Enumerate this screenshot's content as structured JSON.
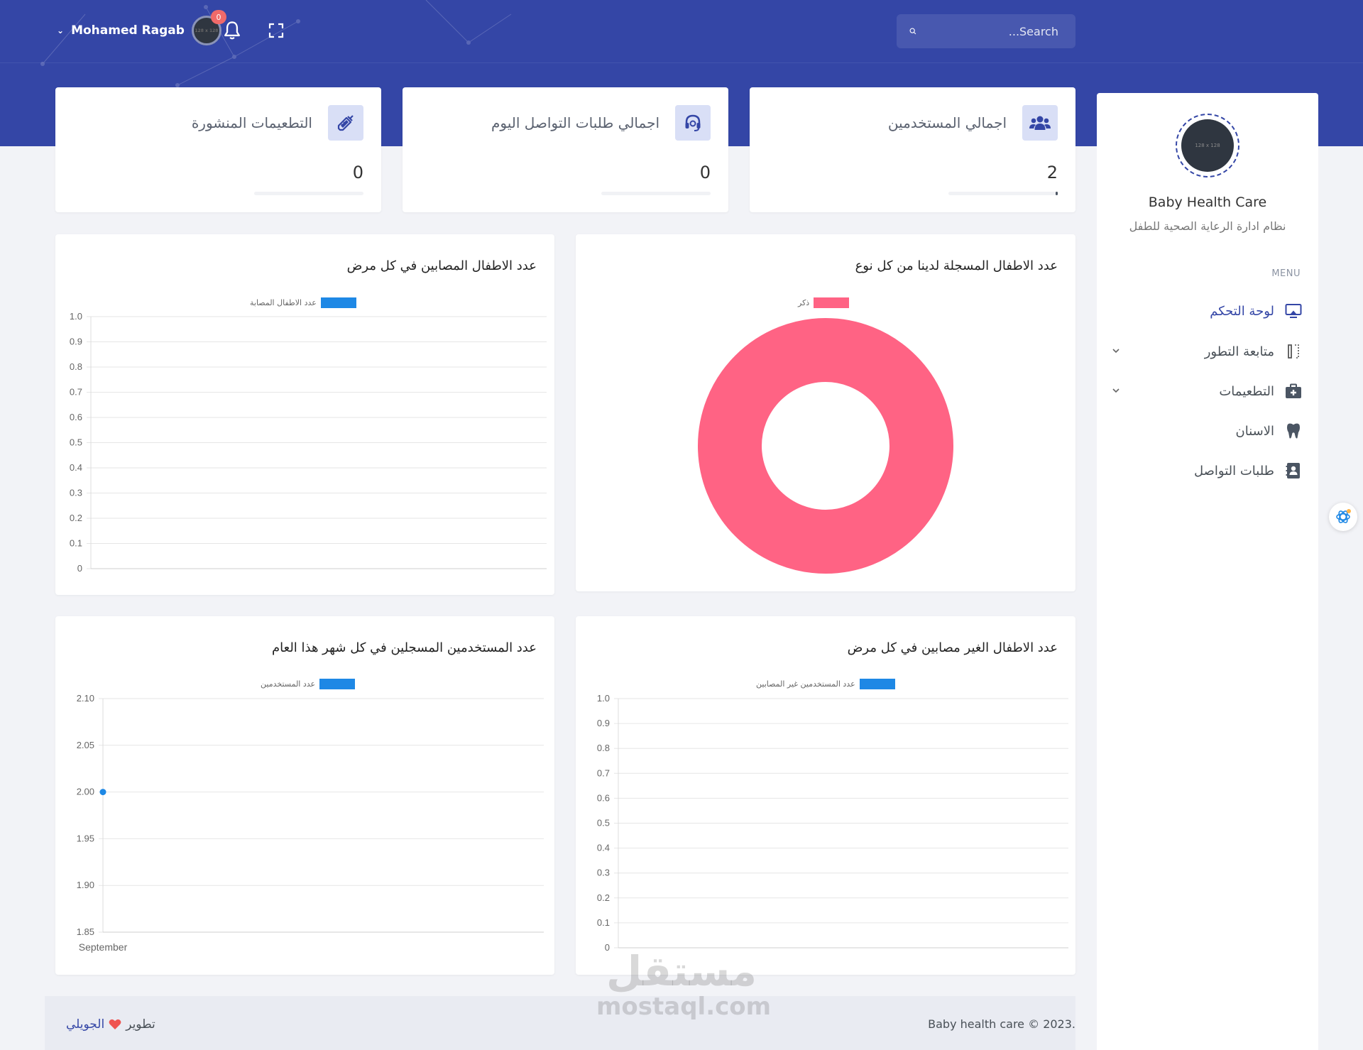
{
  "header": {
    "user_name": "Mohamed Ragab",
    "avatar_text": "128 x 128",
    "notification_count": "0",
    "search_placeholder": "...Search"
  },
  "stats": [
    {
      "title": "اجمالي المستخدمين",
      "value": "2",
      "progress": 0.02
    },
    {
      "title": "اجمالي طلبات التواصل اليوم",
      "value": "0",
      "progress": 0
    },
    {
      "title": "التطعيمات المنشورة",
      "value": "0",
      "progress": 0
    }
  ],
  "charts": {
    "gender": {
      "title": "عدد الاطفال المسجلة لدينا من كل نوع",
      "legend": "ذكر"
    },
    "infected": {
      "title": "عدد الاطفال المصابين في كل مرض",
      "legend": "عدد الاطفال المصابة"
    },
    "non_infected": {
      "title": "عدد الاطفال الغير مصابين في كل مرض",
      "legend": "عدد المستخدمين غير المصابين"
    },
    "users_monthly": {
      "title": "عدد المستخدمين المسجلين في كل شهر هذا العام",
      "legend": "عدد المستخدمين"
    }
  },
  "chart_data": [
    {
      "type": "pie",
      "title": "عدد الاطفال المسجلة لدينا من كل نوع",
      "categories": [
        "ذكر"
      ],
      "values": [
        1
      ],
      "colors": [
        "#ff6384"
      ],
      "donut": true,
      "legend": "top"
    },
    {
      "type": "bar",
      "title": "عدد الاطفال المصابين في كل مرض",
      "categories": [],
      "series": [
        {
          "name": "عدد الاطفال المصابة",
          "values": []
        }
      ],
      "ylim": [
        0,
        1
      ],
      "yticks": [
        "0",
        "0.1",
        "0.2",
        "0.3",
        "0.4",
        "0.5",
        "0.6",
        "0.7",
        "0.8",
        "0.9",
        "1.0"
      ],
      "colors": [
        "#1e88e5"
      ],
      "grid": true,
      "legend": "top"
    },
    {
      "type": "bar",
      "title": "عدد الاطفال الغير مصابين في كل مرض",
      "categories": [],
      "series": [
        {
          "name": "عدد المستخدمين غير المصابين",
          "values": []
        }
      ],
      "ylim": [
        0,
        1
      ],
      "yticks": [
        "0",
        "0.1",
        "0.2",
        "0.3",
        "0.4",
        "0.5",
        "0.6",
        "0.7",
        "0.8",
        "0.9",
        "1.0"
      ],
      "colors": [
        "#1e88e5"
      ],
      "grid": true,
      "legend": "top"
    },
    {
      "type": "line",
      "title": "عدد المستخدمين المسجلين في كل شهر هذا العام",
      "categories": [
        "September"
      ],
      "series": [
        {
          "name": "عدد المستخدمين",
          "values": [
            2
          ]
        }
      ],
      "ylim": [
        1.85,
        2.1
      ],
      "yticks": [
        "1.85",
        "1.90",
        "1.95",
        "2.00",
        "2.05",
        "2.10"
      ],
      "colors": [
        "#1e88e5"
      ],
      "grid": true,
      "legend": "top"
    }
  ],
  "sidebar": {
    "logo_text": "128 x 128",
    "brand_name": "Baby Health Care",
    "brand_subtitle": "نظام ادارة الرعاية الصحية للطفل",
    "menu_label": "MENU",
    "items": [
      {
        "label": "لوحة التحكم",
        "icon": "monitor-icon",
        "active": true
      },
      {
        "label": "متابعة التطور",
        "icon": "columns-icon",
        "has_children": true
      },
      {
        "label": "التطعيمات",
        "icon": "medkit-icon",
        "has_children": true
      },
      {
        "label": "الاسنان",
        "icon": "tooth-icon"
      },
      {
        "label": "طلبات التواصل",
        "icon": "contact-book-icon"
      }
    ]
  },
  "footer": {
    "copyright": "Baby health care © 2023.",
    "credit_prefix": "تطوير",
    "credit_name": "الجويلي"
  },
  "watermark": {
    "ar": "مستقل",
    "en": "mostaql.com"
  },
  "colors": {
    "primary": "#3446a6",
    "pink": "#ff6384",
    "blue": "#1e88e5"
  }
}
